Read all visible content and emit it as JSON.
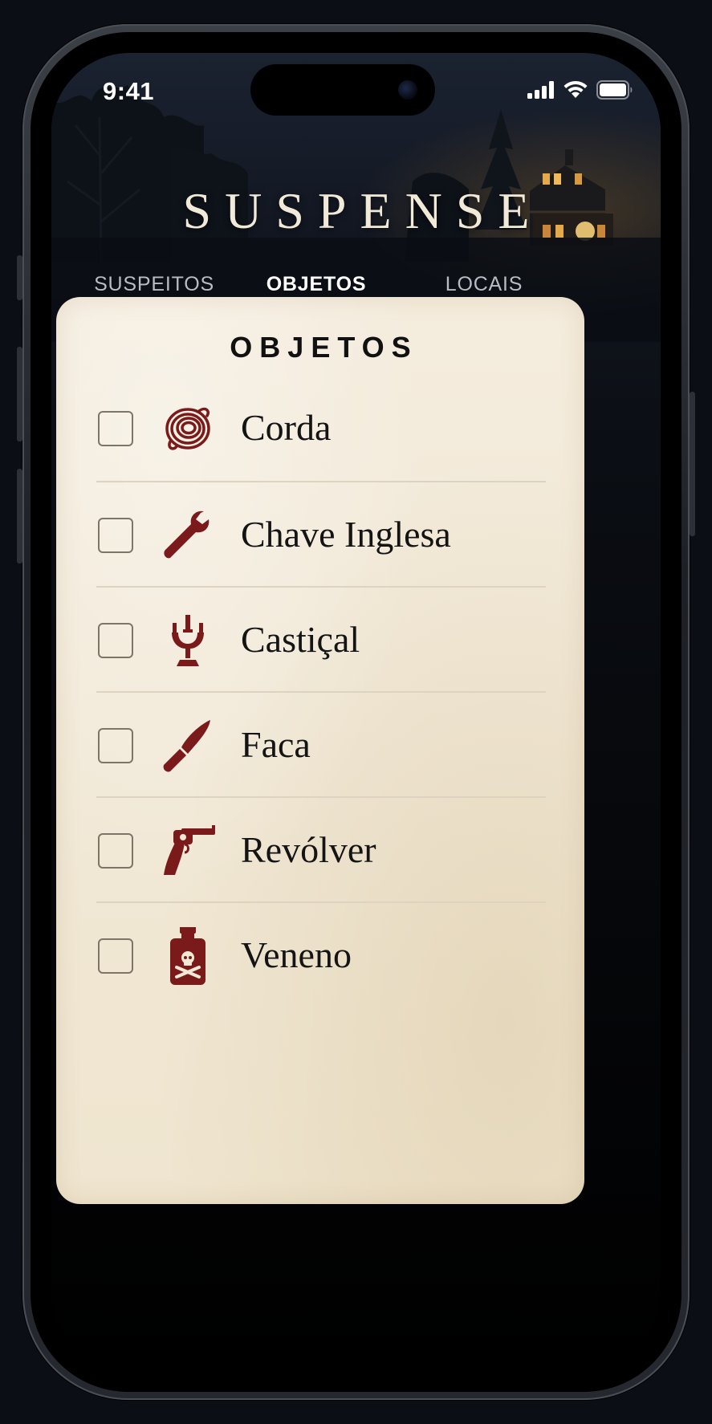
{
  "status_bar": {
    "time": "9:41",
    "icons": [
      "cellular-signal-icon",
      "wifi-icon",
      "battery-icon"
    ]
  },
  "app": {
    "title": "SUSPENSE"
  },
  "tabs": [
    {
      "label": "SUSPEITOS",
      "active": false
    },
    {
      "label": "OBJETOS",
      "active": true
    },
    {
      "label": "LOCAIS",
      "active": false
    }
  ],
  "panel": {
    "heading": "OBJETOS",
    "items": [
      {
        "label": "Corda",
        "icon": "rope-icon",
        "checked": false
      },
      {
        "label": "Chave Inglesa",
        "icon": "wrench-icon",
        "checked": false
      },
      {
        "label": "Castiçal",
        "icon": "candlestick-icon",
        "checked": false
      },
      {
        "label": "Faca",
        "icon": "knife-icon",
        "checked": false
      },
      {
        "label": "Revólver",
        "icon": "revolver-icon",
        "checked": false
      },
      {
        "label": "Veneno",
        "icon": "poison-bottle-icon",
        "checked": false
      }
    ]
  },
  "colors": {
    "accent": "#b3281d",
    "icon": "#7a1a1a",
    "paper": "#f2e9d8",
    "background": "#0b0e14"
  }
}
